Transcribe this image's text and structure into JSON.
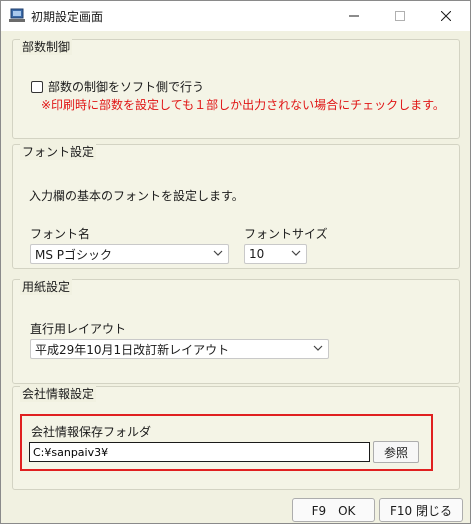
{
  "window": {
    "title": "初期設定画面"
  },
  "copies_group": {
    "title": "部数制御",
    "checkbox_label": "部数の制御をソフト側で行う",
    "checked": false,
    "warning": "※印刷時に部数を設定しても１部しか出力されない場合にチェックします。"
  },
  "font_group": {
    "title": "フォント設定",
    "description": "入力欄の基本のフォントを設定します。",
    "font_name_label": "フォント名",
    "font_name_value": "MS Pゴシック",
    "font_size_label": "フォントサイズ",
    "font_size_value": "10"
  },
  "paper_group": {
    "title": "用紙設定",
    "layout_label": "直行用レイアウト",
    "layout_value": "平成29年10月1日改訂新レイアウト"
  },
  "company_group": {
    "title": "会社情報設定",
    "folder_label": "会社情報保存フォルダ",
    "folder_value": "C:¥sanpaiv3¥",
    "browse_label": "参照"
  },
  "footer": {
    "ok_label": "F9　OK",
    "close_label": "F10 閉じる"
  },
  "colors": {
    "warning": "#e01515",
    "highlight": "#e02020",
    "background": "#f1f1e1"
  }
}
